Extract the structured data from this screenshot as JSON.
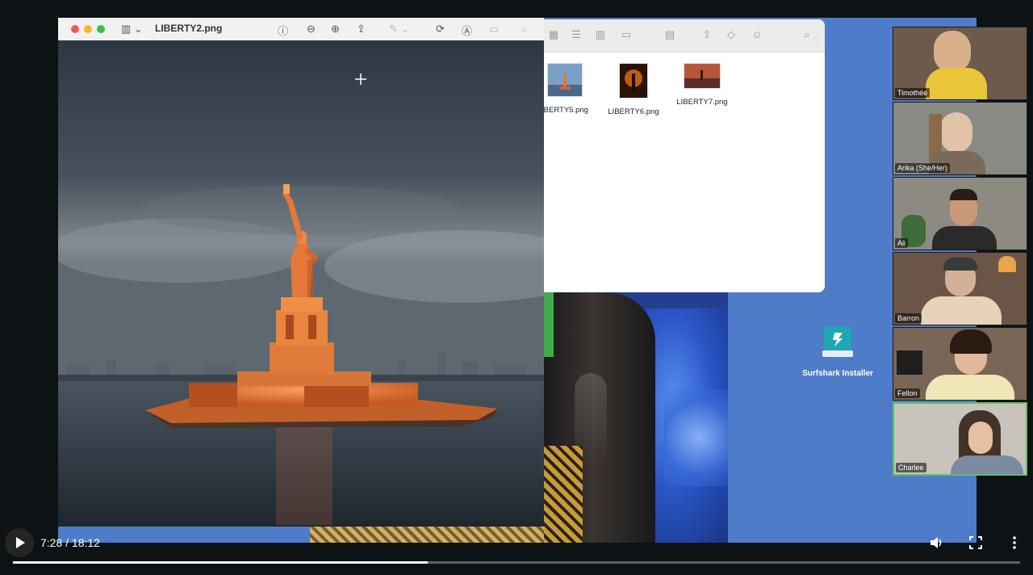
{
  "preview": {
    "title": "LIBERTY2.png",
    "image_description_icon": "statue-of-liberty-image"
  },
  "finder": {
    "files": [
      {
        "name": "LIBERTY5.png",
        "display": "IBERTY5.png"
      },
      {
        "name": "LIBERTY6.png",
        "display": "LIBERTY6.png"
      },
      {
        "name": "LIBERTY7.png",
        "display": "LIBERTY7.png"
      }
    ]
  },
  "desktop": {
    "installer_label": "Surfshark Installer"
  },
  "participants": [
    {
      "name": "Timothée"
    },
    {
      "name": "Arika (She/Her)"
    },
    {
      "name": "Ali"
    },
    {
      "name": "Barron"
    },
    {
      "name": "Fellon"
    },
    {
      "name": "Charlee"
    }
  ],
  "player": {
    "time_display": "7:28 / 18:12",
    "progress": 0.412,
    "icons": [
      "play-icon",
      "volume-icon",
      "fullscreen-icon",
      "more-icon"
    ]
  },
  "colors": {
    "desktop_blue": "#4f7cc8",
    "active_speaker_border": "#5fbf6a",
    "statue_orange": "#e07a3a"
  }
}
